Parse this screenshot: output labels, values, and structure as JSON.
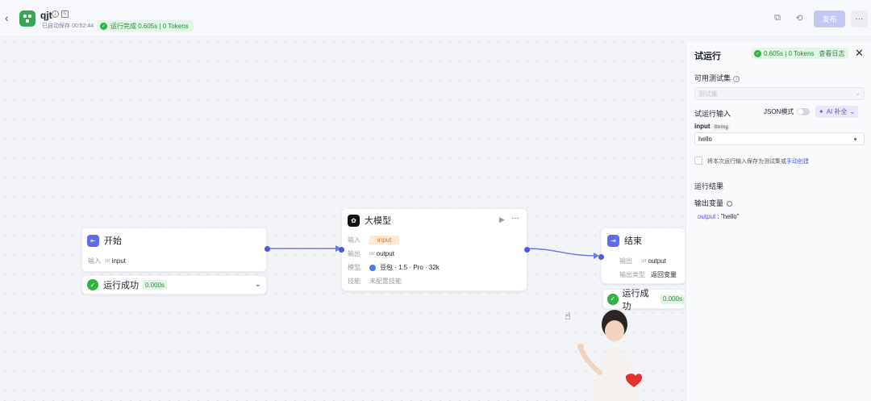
{
  "header": {
    "back_icon": "chevron-left-icon",
    "app_name": "qjt",
    "autosave": "已自动保存 00:52:44",
    "run_status": "运行完成 0.605s | 0 Tokens",
    "publish_label": "发布",
    "more_label": "···"
  },
  "nodes": {
    "start": {
      "title": "开始",
      "input_label": "输入",
      "var_type": "str",
      "var_name": "input",
      "result_label": "运行成功",
      "result_time": "0.000s"
    },
    "llm": {
      "title": "大模型",
      "input_label": "输入",
      "input_value": "input",
      "output_label": "输出",
      "output_type": "str",
      "output_value": "output",
      "model_label": "模型",
      "model_value": "豆包 · 1.5 · Pro · 32k",
      "skill_label": "技能",
      "skill_value": "未配置技能"
    },
    "end": {
      "title": "结束",
      "output_label": "输出",
      "output_type": "str",
      "output_value": "output",
      "output_kind_label": "输出类型",
      "output_kind_value": "返回变量",
      "result_label": "运行成功",
      "result_time": "0.000s"
    }
  },
  "panel": {
    "title": "试运行",
    "status": "0.605s | 0 Tokens",
    "log_link": "查看日志",
    "test_set_label": "可用测试集",
    "test_set_placeholder": "测试集",
    "run_input_label": "试运行输入",
    "json_mode_label": "JSON模式",
    "ai_fill_label": "AI 补全",
    "input_name": "input",
    "input_type": "String",
    "input_value": "hello",
    "save_text": "将本次运行输入保存为测试集或",
    "save_link": "手动创建",
    "result_label": "运行结果",
    "output_var_label": "输出变量",
    "output_key": "output",
    "output_value": " : \"hello\""
  },
  "colors": {
    "accent": "#4e5bd6",
    "success": "#2fb344",
    "start_icon": "#5b6cf0",
    "end_icon": "#5b6cf0",
    "llm_icon": "#111111"
  }
}
